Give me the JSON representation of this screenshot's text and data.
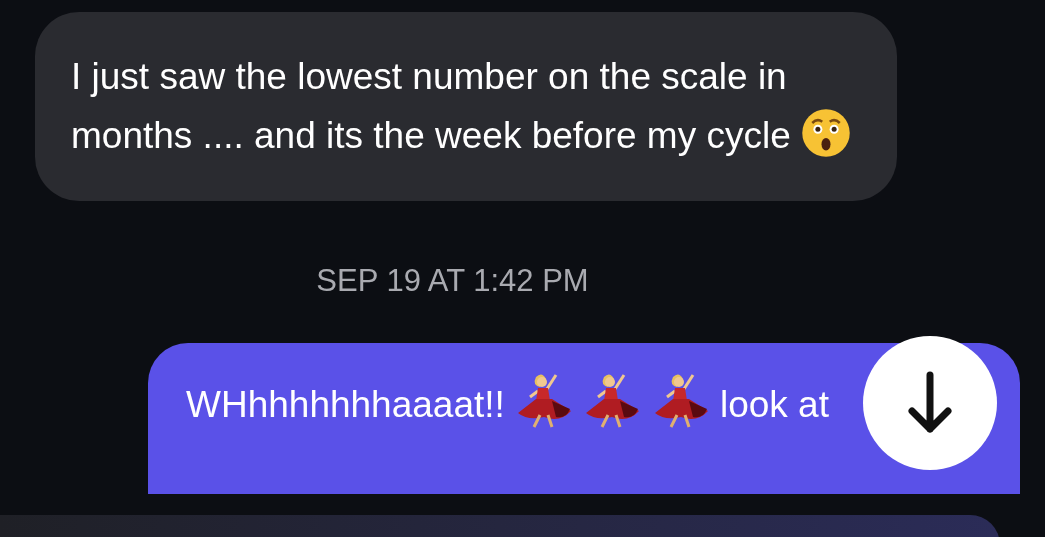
{
  "messages": [
    {
      "kind": "received",
      "segments": [
        {
          "kind": "text",
          "text": "I just saw the lowest number on the scale in months .... and its the week before my cycle"
        },
        {
          "kind": "astonished"
        }
      ]
    },
    {
      "kind": "timestamp",
      "text": "SEP 19 AT 1:42 PM"
    },
    {
      "kind": "sent",
      "segments": [
        {
          "kind": "text",
          "text": "WHhhhhhhhaaaat!!"
        },
        {
          "kind": "dancer"
        },
        {
          "kind": "dancer"
        },
        {
          "kind": "dancer"
        },
        {
          "kind": "text",
          "text": "look at"
        }
      ]
    }
  ]
}
